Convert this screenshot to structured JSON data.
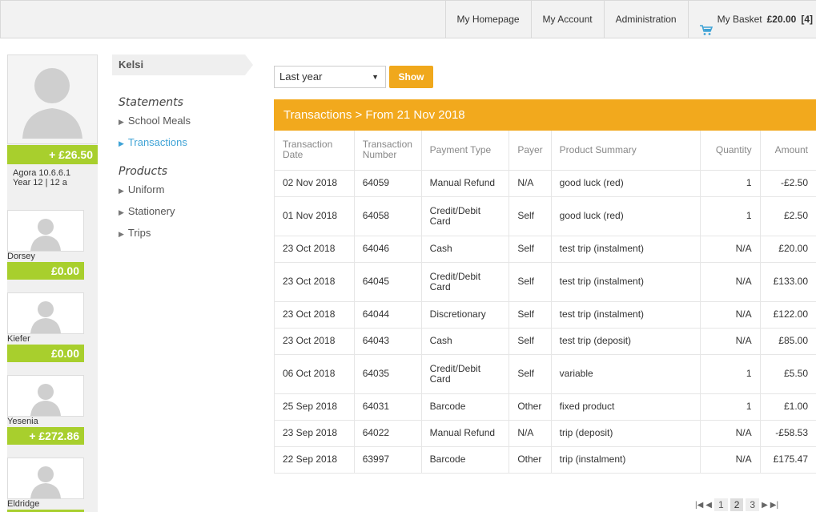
{
  "topnav": {
    "homepage": "My Homepage",
    "account": "My Account",
    "admin": "Administration",
    "basket_label": "My Basket",
    "basket_total": "£20.00",
    "basket_count": "[4]"
  },
  "student": {
    "name": "Kelsi",
    "balance": "+ £26.50",
    "meta_line1": "Agora 10.6.6.1",
    "meta_line2": "Year 12 | 12 a"
  },
  "siblings": [
    {
      "name": "Dorsey",
      "balance": "£0.00"
    },
    {
      "name": "Kiefer",
      "balance": "£0.00"
    },
    {
      "name": "Yesenia",
      "balance": "+ £272.86"
    },
    {
      "name": "Eldridge",
      "balance": ""
    }
  ],
  "sidenav": {
    "statements_title": "Statements",
    "statements": [
      "School Meals",
      "Transactions"
    ],
    "products_title": "Products",
    "products": [
      "Uniform",
      "Stationery",
      "Trips"
    ]
  },
  "filter": {
    "period": "Last year",
    "show_label": "Show"
  },
  "panel": {
    "title": "Transactions > From 21 Nov 2018"
  },
  "table": {
    "headers": [
      "Transaction Date",
      "Transaction Number",
      "Payment Type",
      "Payer",
      "Product Summary",
      "Quantity",
      "Amount"
    ],
    "rows": [
      [
        "02 Nov 2018",
        "64059",
        "Manual Refund",
        "N/A",
        "good luck (red)",
        "1",
        "-£2.50"
      ],
      [
        "01 Nov 2018",
        "64058",
        "Credit/Debit Card",
        "Self",
        "good luck (red)",
        "1",
        "£2.50"
      ],
      [
        "23 Oct 2018",
        "64046",
        "Cash",
        "Self",
        "test trip (instalment)",
        "N/A",
        "£20.00"
      ],
      [
        "23 Oct 2018",
        "64045",
        "Credit/Debit Card",
        "Self",
        "test trip (instalment)",
        "N/A",
        "£133.00"
      ],
      [
        "23 Oct 2018",
        "64044",
        "Discretionary",
        "Self",
        "test trip (instalment)",
        "N/A",
        "£122.00"
      ],
      [
        "23 Oct 2018",
        "64043",
        "Cash",
        "Self",
        "test trip (deposit)",
        "N/A",
        "£85.00"
      ],
      [
        "06 Oct 2018",
        "64035",
        "Credit/Debit Card",
        "Self",
        "variable",
        "1",
        "£5.50"
      ],
      [
        "25 Sep 2018",
        "64031",
        "Barcode",
        "Other",
        "fixed product",
        "1",
        "£1.00"
      ],
      [
        "23 Sep 2018",
        "64022",
        "Manual Refund",
        "N/A",
        "trip (deposit)",
        "N/A",
        "-£58.53"
      ],
      [
        "22 Sep 2018",
        "63997",
        "Barcode",
        "Other",
        "trip (instalment)",
        "N/A",
        "£175.47"
      ]
    ]
  },
  "pager": {
    "pages": [
      "1",
      "2",
      "3"
    ],
    "current": "2"
  },
  "colors": {
    "accent_orange": "#f2a91d",
    "balance_green": "#a8cf2d",
    "link_blue": "#3fa3d6"
  }
}
